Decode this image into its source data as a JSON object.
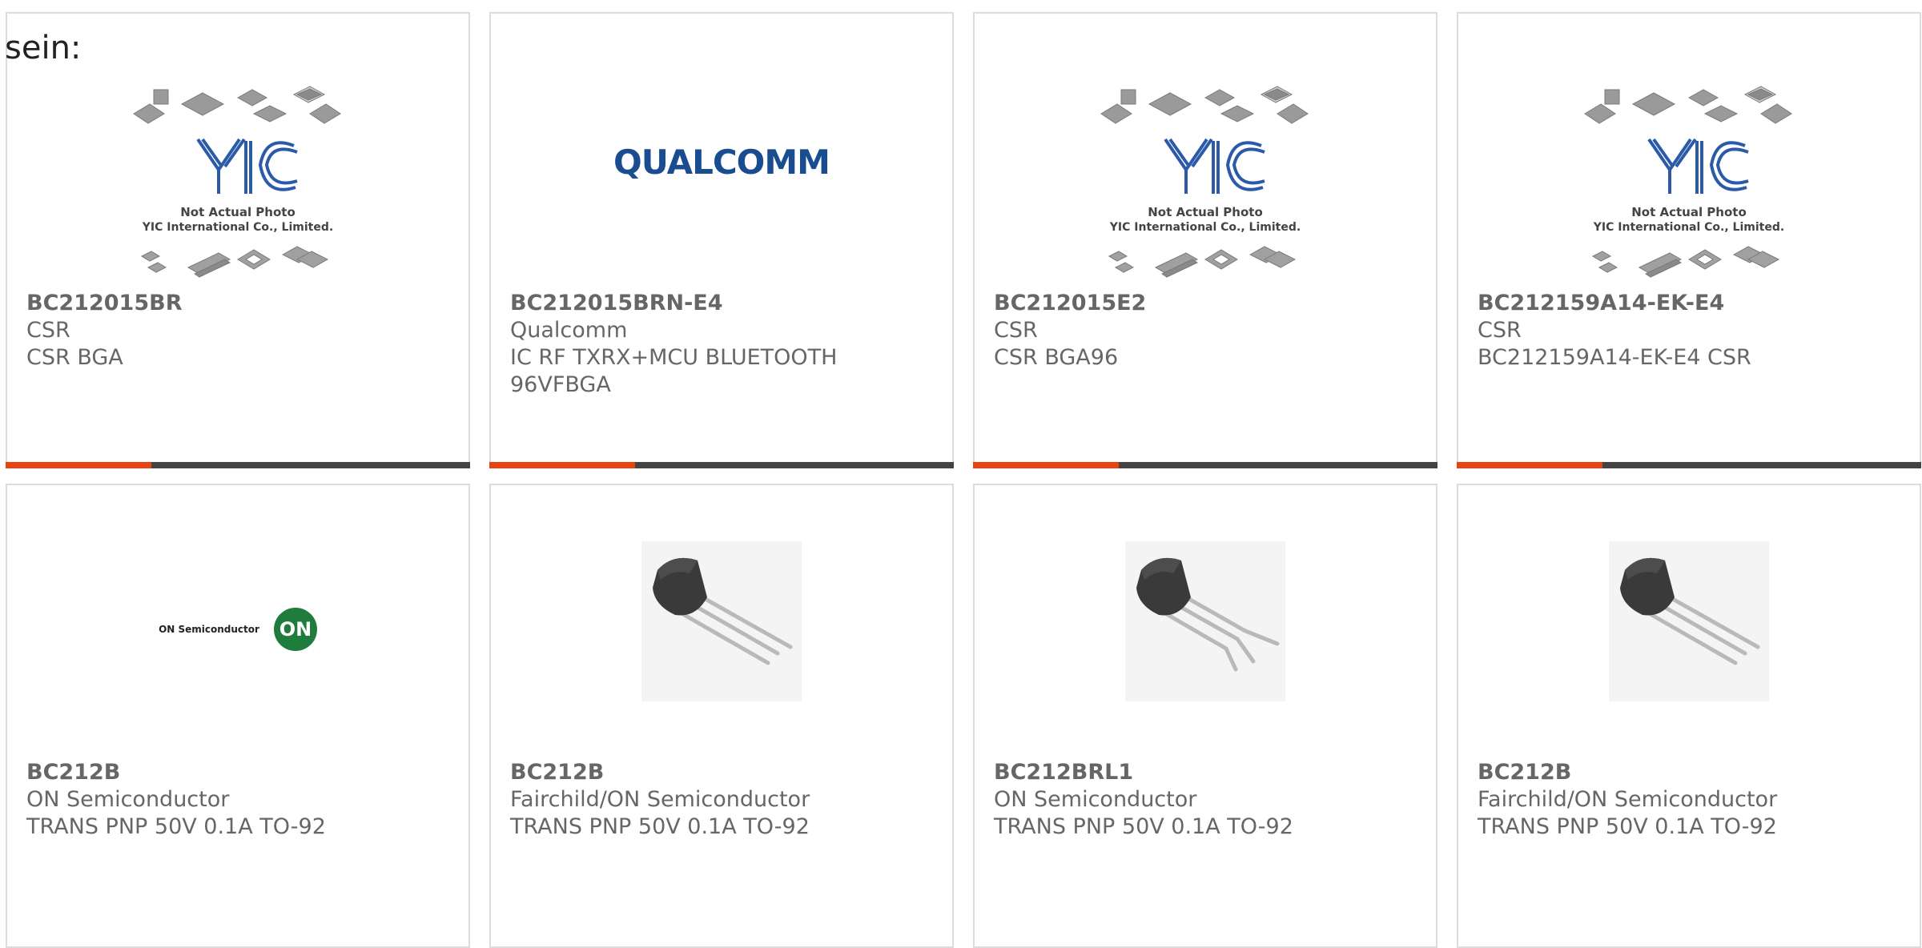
{
  "intro_text": "sein:",
  "placeholder": {
    "line1": "Not Actual Photo",
    "line2": "YIC International Co., Limited.",
    "logo_text": "YIC"
  },
  "brand_logos": {
    "qualcomm": "QUALCOMM",
    "on_semi": "ON Semiconductor",
    "on_badge": "ON"
  },
  "colors": {
    "accent": "#e84412",
    "bar": "#444444",
    "text": "#666666",
    "border": "#dcdcdc",
    "qualcomm_blue": "#1a4d8f",
    "on_green": "#1e7d3c"
  },
  "products": [
    {
      "part": "BC212015BR",
      "maker": "CSR",
      "desc": "CSR BGA",
      "image": "placeholder"
    },
    {
      "part": "BC212015BRN-E4",
      "maker": "Qualcomm",
      "desc": "IC RF TXRX+MCU BLUETOOTH 96VFBGA",
      "image": "qualcomm-logo"
    },
    {
      "part": "BC212015E2",
      "maker": "CSR",
      "desc": "CSR BGA96",
      "image": "placeholder"
    },
    {
      "part": "BC212159A14-EK-E4",
      "maker": "CSR",
      "desc": "BC212159A14-EK-E4 CSR",
      "image": "placeholder"
    },
    {
      "part": "BC212B",
      "maker": "ON Semiconductor",
      "desc": "TRANS PNP 50V 0.1A TO-92",
      "image": "on-semi-logo"
    },
    {
      "part": "BC212B",
      "maker": "Fairchild/ON Semiconductor",
      "desc": "TRANS PNP 50V 0.1A TO-92",
      "image": "to92-transistor"
    },
    {
      "part": "BC212BRL1",
      "maker": "ON Semiconductor",
      "desc": "TRANS PNP 50V 0.1A TO-92",
      "image": "to92-transistor-bent"
    },
    {
      "part": "BC212B",
      "maker": "Fairchild/ON Semiconductor",
      "desc": "TRANS PNP 50V 0.1A TO-92",
      "image": "to92-transistor"
    }
  ]
}
